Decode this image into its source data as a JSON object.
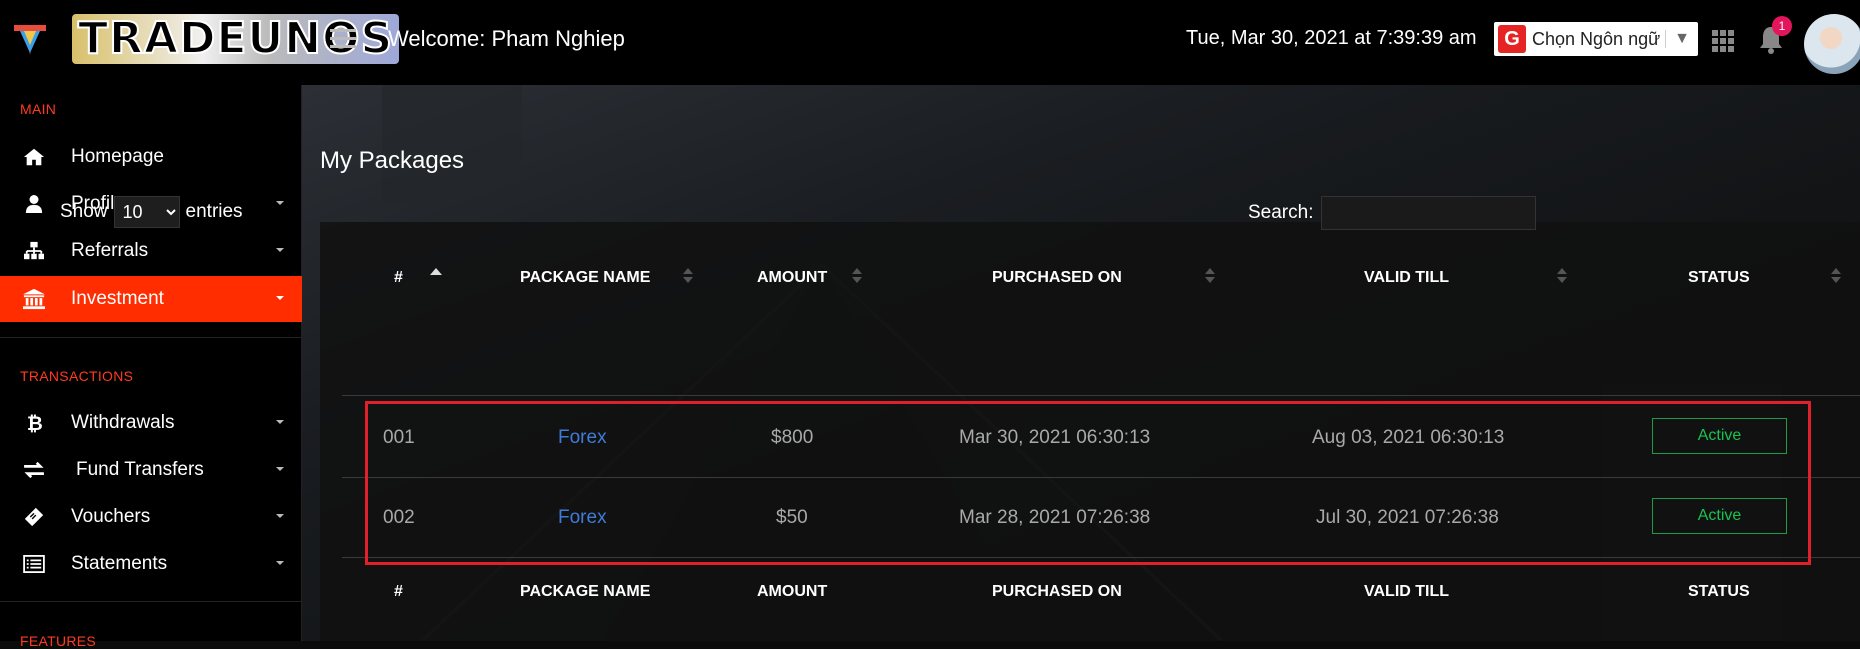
{
  "header": {
    "logo_text": "TRADEUNOS",
    "welcome": "Welcome: Pham Nghiep",
    "datetime": "Tue, Mar 30, 2021 at 7:39:39 am",
    "language_label": "Chọn Ngôn ngữ",
    "language_arrow": "▼",
    "notification_count": "1"
  },
  "sidebar": {
    "main_title": "MAIN",
    "main_items": [
      {
        "label": "Homepage",
        "icon": "home-icon"
      },
      {
        "label": "Profile",
        "icon": "user-icon"
      },
      {
        "label": "Referrals",
        "icon": "sitemap-icon"
      },
      {
        "label": "Investment",
        "icon": "bank-icon"
      }
    ],
    "transactions_title": "TRANSACTIONS",
    "transaction_items": [
      {
        "label": "Withdrawals",
        "icon": "bitcoin-icon"
      },
      {
        "label": "Fund Transfers",
        "icon": "exchange-icon"
      },
      {
        "label": "Vouchers",
        "icon": "ticket-icon"
      },
      {
        "label": "Statements",
        "icon": "list-icon"
      }
    ],
    "features_title": "FEATURES"
  },
  "page": {
    "title": "My Packages",
    "show_label": "Show",
    "entries_value": "10",
    "entries_label": "entries",
    "search_label": "Search:"
  },
  "table": {
    "columns": [
      "#",
      "PACKAGE NAME",
      "AMOUNT",
      "PURCHASED ON",
      "VALID TILL",
      "STATUS"
    ],
    "rows": [
      {
        "id": "001",
        "package": "Forex",
        "amount": "$800",
        "purchased": "Mar 30, 2021 06:30:13",
        "valid": "Aug 03, 2021 06:30:13",
        "status": "Active"
      },
      {
        "id": "002",
        "package": "Forex",
        "amount": "$50",
        "purchased": "Mar 28, 2021 07:26:38",
        "valid": "Jul 30, 2021 07:26:38",
        "status": "Active"
      }
    ]
  },
  "colors": {
    "accent": "#ff2d00",
    "link": "#3f7bd8",
    "status_active": "#19c24f",
    "highlight": "#e0202a"
  }
}
